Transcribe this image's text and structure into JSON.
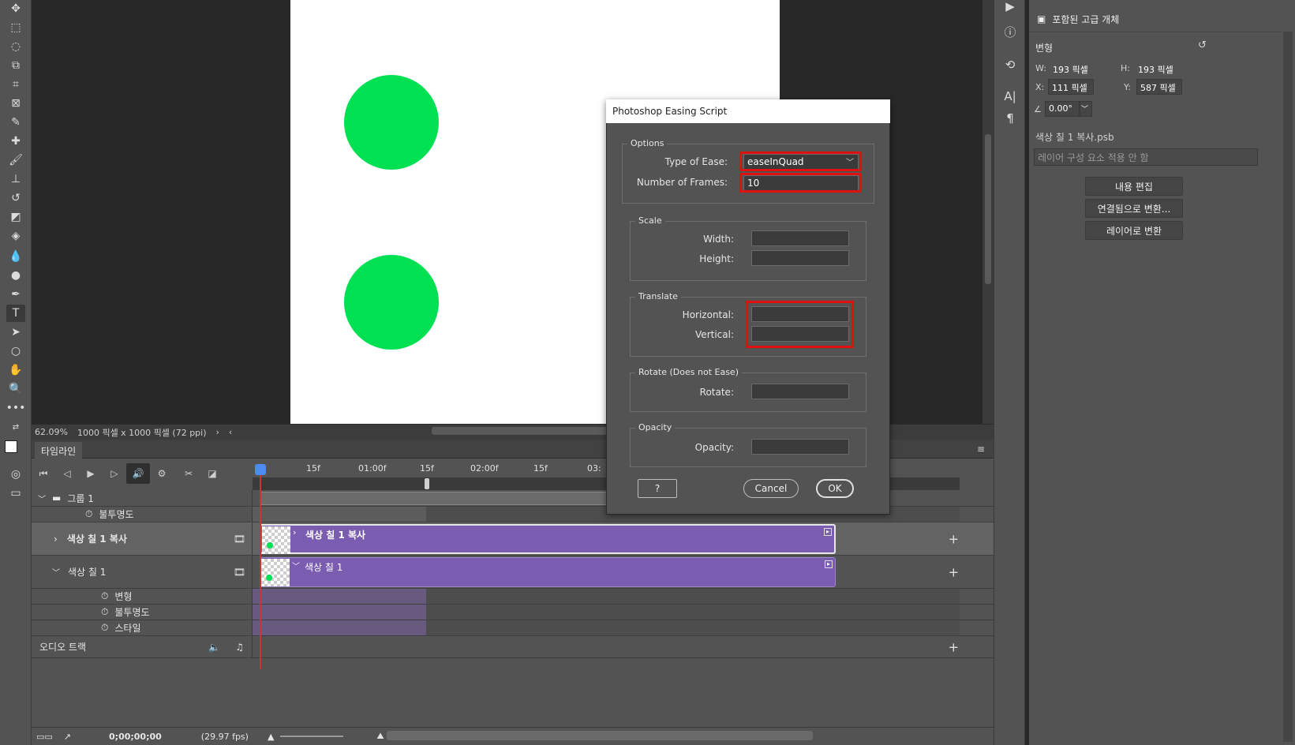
{
  "canvas": {
    "zoom": "62.09%",
    "doc_info": "1000 픽셀 x 1000 픽셀 (72 ppi)",
    "circle_color": "#00e053"
  },
  "timeline": {
    "tab": "타임라인",
    "ruler_labels": [
      "15f",
      "01:00f",
      "15f",
      "02:00f",
      "15f",
      "03:"
    ],
    "tracks": {
      "group": "그룹 1",
      "group_opacity": "불투명도",
      "copy_layer": "색상 칠 1 복사",
      "layer": "색상 칠 1",
      "transform": "변형",
      "opacity": "불투명도",
      "style": "스타일",
      "audio": "오디오 트랙"
    },
    "clips": {
      "copy_label": "색상 칠 1 복사",
      "layer_label": "색상 칠 1"
    },
    "timecode": "0;00;00;00",
    "fps": "(29.97 fps)"
  },
  "properties": {
    "header": "포함된 고급 개체",
    "section": "변형",
    "w_label": "W:",
    "w_value": "193 픽셀",
    "h_label": "H:",
    "h_value": "193 픽셀",
    "x_label": "X:",
    "x_value": "111 픽셀",
    "y_label": "Y:",
    "y_value": "587 픽셀",
    "angle": "0.00°",
    "file_name": "색상 칠 1 복사.psb",
    "comp_select": "레이어 구성 요소 적용 안 함",
    "btn_edit": "내용 편집",
    "btn_linked": "연결됨으로 변환...",
    "btn_layer": "레이어로 변환"
  },
  "dialog": {
    "title": "Photoshop Easing Script",
    "options_title": "Options",
    "ease_label": "Type of Ease:",
    "ease_value": "easeInQuad",
    "frames_label": "Number of Frames:",
    "frames_value": "10",
    "scale_title": "Scale",
    "width_label": "Width:",
    "height_label": "Height:",
    "translate_title": "Translate",
    "horizontal_label": "Horizontal:",
    "vertical_label": "Vertical:",
    "rotate_title": "Rotate (Does not Ease)",
    "rotate_label": "Rotate:",
    "opacity_title": "Opacity",
    "opacity_label": "Opacity:",
    "help_btn": "?",
    "cancel_btn": "Cancel",
    "ok_btn": "OK",
    "highlight_color": "#e01010"
  }
}
